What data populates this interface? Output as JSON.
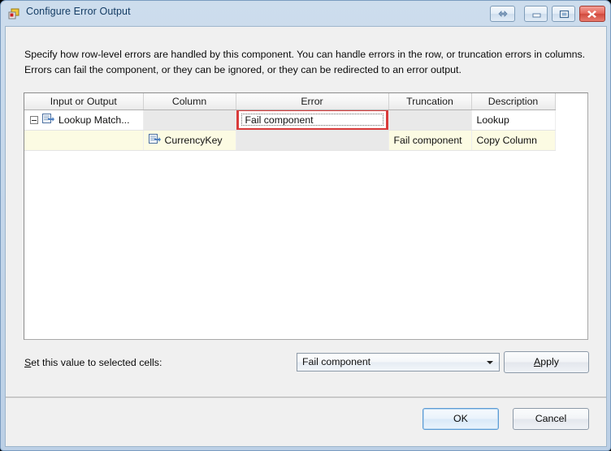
{
  "window": {
    "title": "Configure Error Output",
    "icon": "component-icon",
    "buttons": {
      "resize": "resize-arrows",
      "minimize": "minimize",
      "maximize": "maximize",
      "close": "close"
    }
  },
  "instruction": "Specify how row-level errors are handled by this component. You can handle errors in the row, or truncation errors in columns. Errors can fail the component, or they can be ignored, or they can be redirected to an error output.",
  "grid": {
    "headers": [
      "Input or Output",
      "Column",
      "Error",
      "Truncation",
      "Description"
    ],
    "rows": [
      {
        "input_or_output": "Lookup Match...",
        "column": "",
        "error": "Fail component",
        "truncation": "",
        "description": "Lookup",
        "expander": "collapse-minus",
        "icon": "output-arrow-icon",
        "selected_cell": "error"
      },
      {
        "input_or_output": "",
        "column": "CurrencyKey",
        "error": "",
        "truncation": "Fail component",
        "description": "Copy Column",
        "icon": "column-arrow-icon"
      }
    ]
  },
  "footer": {
    "set_value_label_accel": "S",
    "set_value_label_rest": "et this value to selected cells:",
    "value_combo": "Fail component",
    "apply_accel": "A",
    "apply_rest": "pply",
    "ok": "OK",
    "cancel": "Cancel"
  },
  "colors": {
    "selection_red": "#d93b3b",
    "child_row_yellow": "#fcfbe3",
    "disabled_gray": "#e9e9e9",
    "title_text": "#143c64"
  }
}
